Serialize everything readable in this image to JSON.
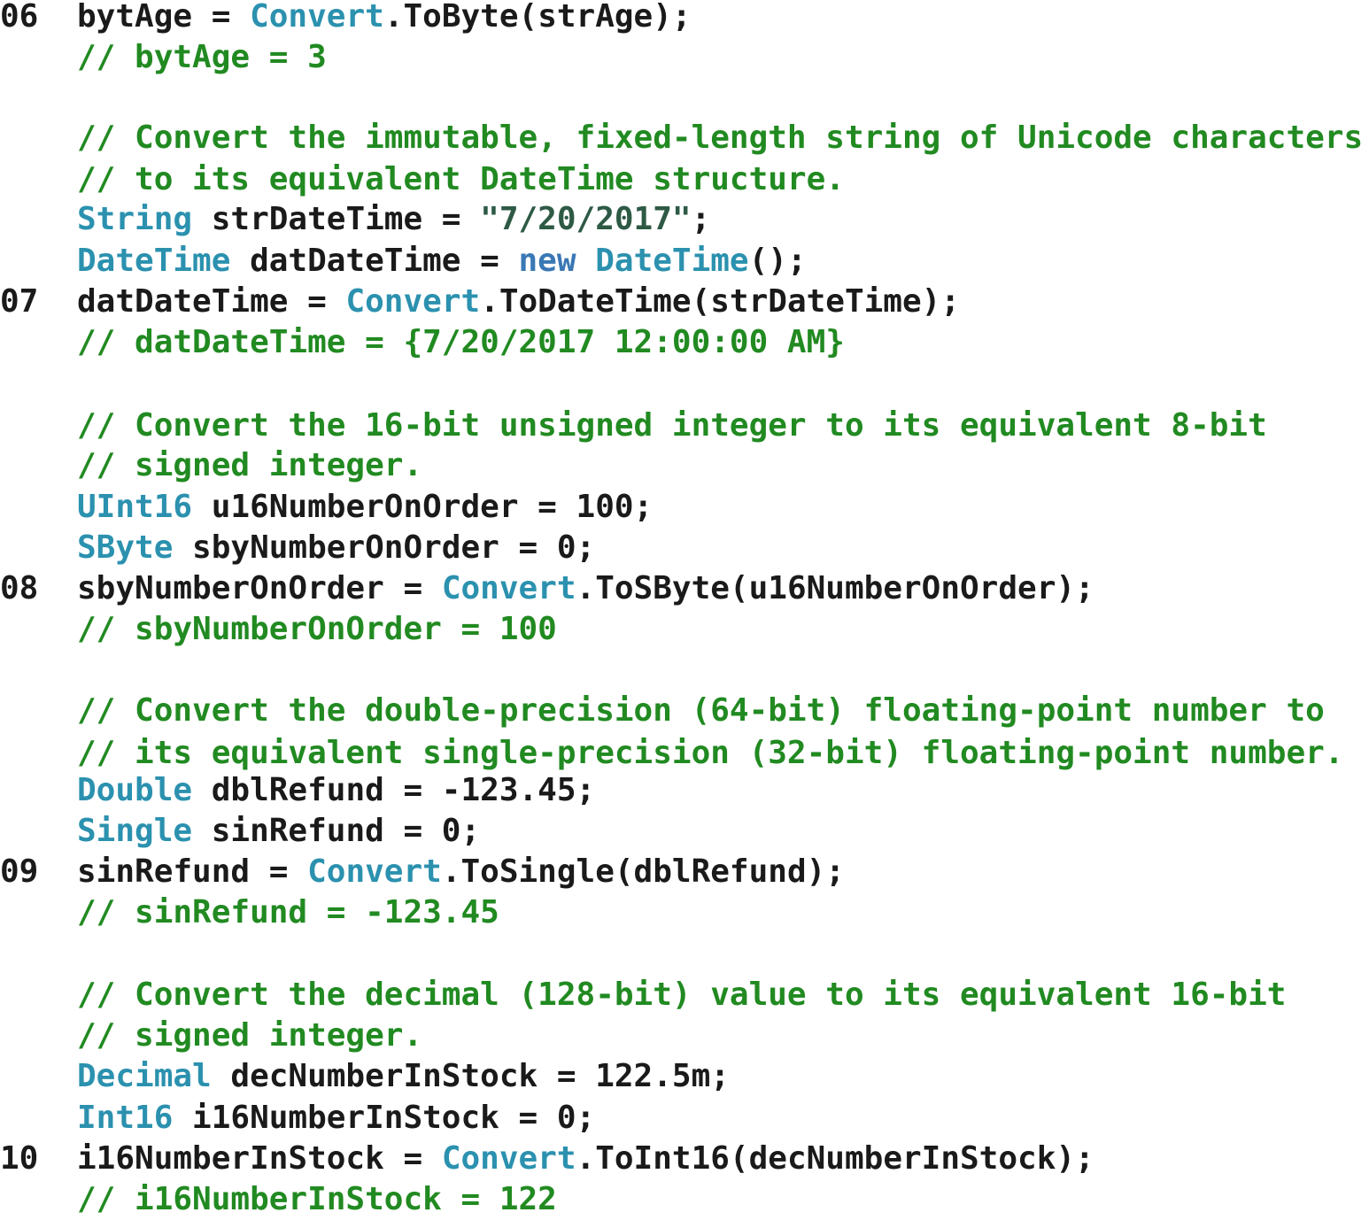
{
  "colors": {
    "plain": "#1a1a1a",
    "type": "#2b91af",
    "keyword": "#3a78b5",
    "comment": "#218a21",
    "string": "#2e5a45"
  },
  "lines": [
    {
      "num": "06",
      "tokens": [
        {
          "t": "bytAge = ",
          "c": "plain"
        },
        {
          "t": "Convert",
          "c": "type"
        },
        {
          "t": ".ToByte(strAge);",
          "c": "plain"
        }
      ]
    },
    {
      "num": "",
      "tokens": [
        {
          "t": "// bytAge = 3",
          "c": "comment"
        }
      ]
    },
    {
      "num": "",
      "tokens": []
    },
    {
      "num": "",
      "tokens": [
        {
          "t": "// Convert the immutable, fixed-length string of Unicode characters",
          "c": "comment"
        }
      ]
    },
    {
      "num": "",
      "tokens": [
        {
          "t": "// to its equivalent DateTime structure.",
          "c": "comment"
        }
      ]
    },
    {
      "num": "",
      "tokens": [
        {
          "t": "String",
          "c": "type"
        },
        {
          "t": " strDateTime = ",
          "c": "plain"
        },
        {
          "t": "\"7/20/2017\"",
          "c": "string"
        },
        {
          "t": ";",
          "c": "plain"
        }
      ]
    },
    {
      "num": "",
      "tokens": [
        {
          "t": "DateTime",
          "c": "type"
        },
        {
          "t": " datDateTime = ",
          "c": "plain"
        },
        {
          "t": "new",
          "c": "keyword"
        },
        {
          "t": " ",
          "c": "plain"
        },
        {
          "t": "DateTime",
          "c": "type"
        },
        {
          "t": "();",
          "c": "plain"
        }
      ]
    },
    {
      "num": "07",
      "tokens": [
        {
          "t": "datDateTime = ",
          "c": "plain"
        },
        {
          "t": "Convert",
          "c": "type"
        },
        {
          "t": ".ToDateTime(strDateTime);",
          "c": "plain"
        }
      ]
    },
    {
      "num": "",
      "tokens": [
        {
          "t": "// datDateTime = {7/20/2017 12:00:00 AM}",
          "c": "comment"
        }
      ]
    },
    {
      "num": "",
      "tokens": []
    },
    {
      "num": "",
      "tokens": [
        {
          "t": "// Convert the 16-bit unsigned integer to its equivalent 8-bit",
          "c": "comment"
        }
      ]
    },
    {
      "num": "",
      "tokens": [
        {
          "t": "// signed integer.",
          "c": "comment"
        }
      ]
    },
    {
      "num": "",
      "tokens": [
        {
          "t": "UInt16",
          "c": "type"
        },
        {
          "t": " u16NumberOnOrder = 100;",
          "c": "plain"
        }
      ]
    },
    {
      "num": "",
      "tokens": [
        {
          "t": "SByte",
          "c": "type"
        },
        {
          "t": " sbyNumberOnOrder = 0;",
          "c": "plain"
        }
      ]
    },
    {
      "num": "08",
      "tokens": [
        {
          "t": "sbyNumberOnOrder = ",
          "c": "plain"
        },
        {
          "t": "Convert",
          "c": "type"
        },
        {
          "t": ".ToSByte(u16NumberOnOrder);",
          "c": "plain"
        }
      ]
    },
    {
      "num": "",
      "tokens": [
        {
          "t": "// sbyNumberOnOrder = 100",
          "c": "comment"
        }
      ]
    },
    {
      "num": "",
      "tokens": []
    },
    {
      "num": "",
      "tokens": [
        {
          "t": "// Convert the double-precision (64-bit) floating-point number to",
          "c": "comment"
        }
      ]
    },
    {
      "num": "",
      "tokens": [
        {
          "t": "// its equivalent single-precision (32-bit) floating-point number.",
          "c": "comment"
        }
      ]
    },
    {
      "num": "",
      "tokens": [
        {
          "t": "Double",
          "c": "type"
        },
        {
          "t": " dblRefund = -123.45;",
          "c": "plain"
        }
      ]
    },
    {
      "num": "",
      "tokens": [
        {
          "t": "Single",
          "c": "type"
        },
        {
          "t": " sinRefund = 0;",
          "c": "plain"
        }
      ]
    },
    {
      "num": "09",
      "tokens": [
        {
          "t": "sinRefund = ",
          "c": "plain"
        },
        {
          "t": "Convert",
          "c": "type"
        },
        {
          "t": ".ToSingle(dblRefund);",
          "c": "plain"
        }
      ]
    },
    {
      "num": "",
      "tokens": [
        {
          "t": "// sinRefund = -123.45",
          "c": "comment"
        }
      ]
    },
    {
      "num": "",
      "tokens": []
    },
    {
      "num": "",
      "tokens": [
        {
          "t": "// Convert the decimal (128-bit) value to its equivalent 16-bit",
          "c": "comment"
        }
      ]
    },
    {
      "num": "",
      "tokens": [
        {
          "t": "// signed integer.",
          "c": "comment"
        }
      ]
    },
    {
      "num": "",
      "tokens": [
        {
          "t": "Decimal",
          "c": "type"
        },
        {
          "t": " decNumberInStock = 122.5m;",
          "c": "plain"
        }
      ]
    },
    {
      "num": "",
      "tokens": [
        {
          "t": "Int16",
          "c": "type"
        },
        {
          "t": " i16NumberInStock = 0;",
          "c": "plain"
        }
      ]
    },
    {
      "num": "10",
      "tokens": [
        {
          "t": "i16NumberInStock = ",
          "c": "plain"
        },
        {
          "t": "Convert",
          "c": "type"
        },
        {
          "t": ".ToInt16(decNumberInStock);",
          "c": "plain"
        }
      ]
    },
    {
      "num": "",
      "tokens": [
        {
          "t": "// i16NumberInStock = 122",
          "c": "comment"
        }
      ]
    }
  ]
}
